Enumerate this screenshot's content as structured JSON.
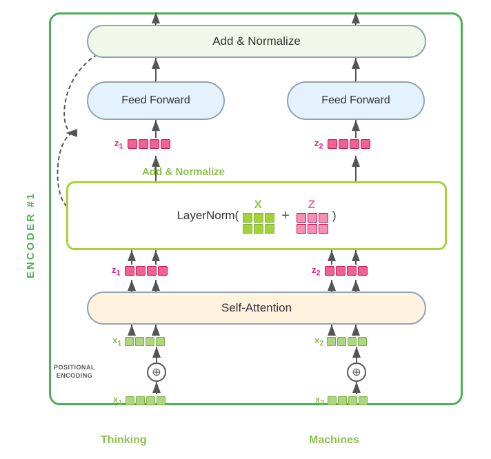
{
  "encoder": {
    "label": "ENCODER #1",
    "add_norm_top": "Add & Normalize",
    "feed_forward_left": "Feed Forward",
    "feed_forward_right": "Feed Forward",
    "add_norm_middle": "Add & Normalize",
    "layernorm_text": "LayerNorm(",
    "layernorm_x": "X",
    "layernorm_z": "Z",
    "layernorm_close": ")",
    "self_attention": "Self-Attention",
    "positional_encoding": "POSITIONAL\nENCODING",
    "word_left": "Thinking",
    "word_right": "Machines",
    "z1_label": "z",
    "z1_sub": "1",
    "z2_label": "z",
    "z2_sub": "2",
    "x1_label": "x",
    "x1_sub": "1",
    "x2_label": "x",
    "x2_sub": "2"
  },
  "colors": {
    "green_border": "#4caf50",
    "green_light": "#8bc34a",
    "pink": "#e91e8c",
    "blue_light": "#e3f2fd",
    "yellow_light": "#fff3e0",
    "cream": "#f1f8e9"
  }
}
